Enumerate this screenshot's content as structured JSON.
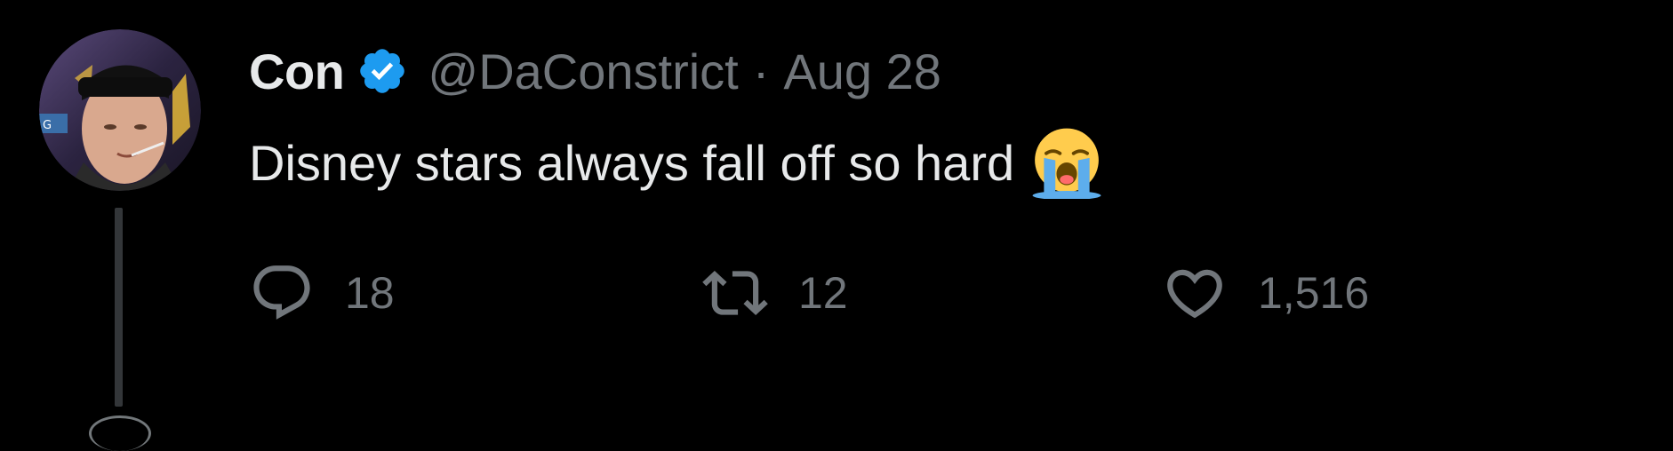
{
  "tweet": {
    "author": {
      "display_name": "Con",
      "handle": "@DaConstrict",
      "verified": true,
      "avatar_icon": "avatar-photo"
    },
    "separator": "·",
    "date": "Aug 28",
    "text": "Disney stars always fall off so hard",
    "emoji": "loudly-crying-face",
    "actions": {
      "replies": "18",
      "retweets": "12",
      "likes": "1,516"
    }
  },
  "colors": {
    "background": "#000000",
    "primary_text": "#e7e9ea",
    "secondary_text": "#71767b",
    "verified_badge": "#1d9bf0",
    "thread_line": "#333639"
  }
}
